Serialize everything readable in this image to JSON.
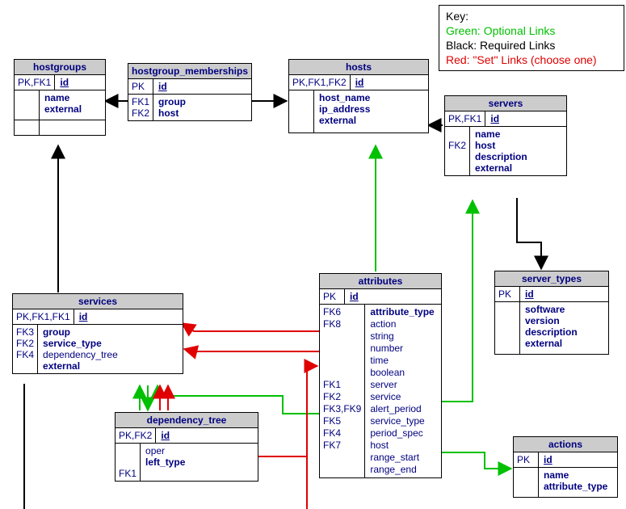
{
  "key": {
    "heading": "Key:",
    "green": "Green: Optional Links",
    "black": "Black: Required Links",
    "red": "Red: \"Set\" Links (choose one)"
  },
  "hostgroups": {
    "title": "hostgroups",
    "pk_key": "PK,FK1",
    "pk_field": "id",
    "f1": "name",
    "f2": "external"
  },
  "hostgroup_memberships": {
    "title": "hostgroup_memberships",
    "pk_key": "PK",
    "pk_field": "id",
    "k1": "FK1",
    "k2": "FK2",
    "f1": "group",
    "f2": "host"
  },
  "hosts": {
    "title": "hosts",
    "pk_key": "PK,FK1,FK2",
    "pk_field": "id",
    "f1": "host_name",
    "f2": "ip_address",
    "f3": "external"
  },
  "servers": {
    "title": "servers",
    "pk_key": "PK,FK1",
    "pk_field": "id",
    "k2": "FK2",
    "f1": "name",
    "f2": "host",
    "f3": "description",
    "f4": "external"
  },
  "server_types": {
    "title": "server_types",
    "pk_key": "PK",
    "pk_field": "id",
    "f1": "software",
    "f2": "version",
    "f3": "description",
    "f4": "external"
  },
  "services": {
    "title": "services",
    "pk_key": "PK,FK1,FK1",
    "pk_field": "id",
    "k3": "FK3",
    "k4": "FK2",
    "k5": "FK4",
    "f1": "group",
    "f2": "service_type",
    "f3": "dependency_tree",
    "f4": "external"
  },
  "dependency_tree": {
    "title": "dependency_tree",
    "pk_key": "PK,FK2",
    "pk_field": "id",
    "k1": "FK1",
    "f1": "oper",
    "f2": "left_type"
  },
  "attributes": {
    "title": "attributes",
    "pk_key": "PK",
    "pk_field": "id",
    "k6": "FK6",
    "k8": "FK8",
    "k1": "FK1",
    "k2": "FK2",
    "k39": "FK3,FK9",
    "k5": "FK5",
    "k4": "FK4",
    "k7": "FK7",
    "f_attribute_type": "attribute_type",
    "f_action": "action",
    "f_string": "string",
    "f_number": "number",
    "f_time": "time",
    "f_boolean": "boolean",
    "f_server": "server",
    "f_service": "service",
    "f_alert_period": "alert_period",
    "f_service_type": "service_type",
    "f_period_spec": "period_spec",
    "f_host": "host",
    "f_range_start": "range_start",
    "f_range_end": "range_end"
  },
  "actions": {
    "title": "actions",
    "pk_key": "PK",
    "pk_field": "id",
    "f1": "name",
    "f2": "attribute_type"
  },
  "chart_data": {
    "type": "table",
    "title": "Entity-Relationship Diagram",
    "key_legend": [
      {
        "label": "Green: Optional Links",
        "color": "#00c000"
      },
      {
        "label": "Black: Required Links",
        "color": "#000000"
      },
      {
        "label": "Red: \"Set\" Links (choose one)",
        "color": "#e00000"
      }
    ],
    "entities": [
      {
        "name": "hostgroups",
        "pk": "PK,FK1",
        "fields": [
          "id",
          "name",
          "external"
        ]
      },
      {
        "name": "hostgroup_memberships",
        "pk": "PK",
        "fields": [
          "id",
          "group",
          "host"
        ],
        "fks": [
          "FK1",
          "FK2"
        ]
      },
      {
        "name": "hosts",
        "pk": "PK,FK1,FK2",
        "fields": [
          "id",
          "host_name",
          "ip_address",
          "external"
        ]
      },
      {
        "name": "servers",
        "pk": "PK,FK1",
        "fields": [
          "id",
          "name",
          "host",
          "description",
          "external"
        ],
        "fks": [
          "FK2"
        ]
      },
      {
        "name": "server_types",
        "pk": "PK",
        "fields": [
          "id",
          "software",
          "version",
          "description",
          "external"
        ]
      },
      {
        "name": "services",
        "pk": "PK,FK1,FK1",
        "fields": [
          "id",
          "group",
          "service_type",
          "dependency_tree",
          "external"
        ],
        "fks": [
          "FK3",
          "FK2",
          "FK4"
        ]
      },
      {
        "name": "dependency_tree",
        "pk": "PK,FK2",
        "fields": [
          "id",
          "oper",
          "left_type"
        ],
        "fks": [
          "FK1"
        ]
      },
      {
        "name": "attributes",
        "pk": "PK",
        "fields": [
          "id",
          "attribute_type",
          "action",
          "string",
          "number",
          "time",
          "boolean",
          "server",
          "service",
          "alert_period",
          "service_type",
          "period_spec",
          "host",
          "range_start",
          "range_end"
        ],
        "fks": [
          "FK6",
          "FK8",
          "FK1",
          "FK2",
          "FK3,FK9",
          "FK5",
          "FK4",
          "FK7"
        ]
      },
      {
        "name": "actions",
        "pk": "PK",
        "fields": [
          "id",
          "name",
          "attribute_type"
        ]
      }
    ],
    "relationships": [
      {
        "from": "hostgroup_memberships.group",
        "to": "hostgroups",
        "kind": "required"
      },
      {
        "from": "hostgroup_memberships.host",
        "to": "hosts",
        "kind": "required"
      },
      {
        "from": "servers.host",
        "to": "hosts",
        "kind": "required"
      },
      {
        "from": "servers",
        "to": "server_types",
        "kind": "required"
      },
      {
        "from": "attributes.host",
        "to": "hosts",
        "kind": "optional"
      },
      {
        "from": "attributes.server",
        "to": "servers",
        "kind": "optional"
      },
      {
        "from": "attributes.service",
        "to": "services",
        "kind": "optional"
      },
      {
        "from": "attributes.action",
        "to": "actions",
        "kind": "optional"
      },
      {
        "from": "services.group",
        "to": "hostgroups",
        "kind": "required"
      },
      {
        "from": "services.dependency_tree",
        "to": "dependency_tree",
        "kind": "optional"
      },
      {
        "from": "dependency_tree.left",
        "to": "services",
        "kind": "set"
      },
      {
        "from": "dependency_tree.left",
        "to": "attributes",
        "kind": "set"
      },
      {
        "from": "attributes (set)",
        "to": "services",
        "kind": "set"
      }
    ]
  }
}
